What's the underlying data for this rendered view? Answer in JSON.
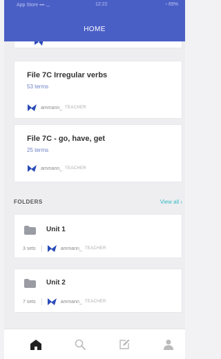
{
  "status_bar": {
    "carrier": "App Store ▪▪▪ ◡",
    "time": "12:22",
    "battery": "▫ 69%"
  },
  "header": {
    "title": "HOME"
  },
  "sets": [
    {
      "title": "File 7C Irregular verbs",
      "terms": "53 terms",
      "creator": "ammann_",
      "role": "TEACHER"
    },
    {
      "title": "File 7C - go, have, get",
      "terms": "25 terms",
      "creator": "ammann_",
      "role": "TEACHER"
    }
  ],
  "folders_section": {
    "label": "FOLDERS",
    "view_all": "View all  ›"
  },
  "folders": [
    {
      "title": "Unit 1",
      "sets": "3 sets",
      "creator": "ammann_",
      "role": "TEACHER"
    },
    {
      "title": "Unit 2",
      "sets": "7 sets",
      "creator": "ammann_",
      "role": "TEACHER"
    }
  ],
  "bottom_nav": {
    "items": [
      {
        "icon": "home-icon",
        "active": true
      },
      {
        "icon": "search-icon",
        "active": false
      },
      {
        "icon": "create-icon",
        "active": false
      },
      {
        "icon": "profile-icon",
        "active": false
      }
    ]
  },
  "colors": {
    "brand": "#4a5fc6",
    "link": "#35b8c6",
    "terms": "#6a7fc8",
    "creator_badge": "#2a4bb8"
  }
}
